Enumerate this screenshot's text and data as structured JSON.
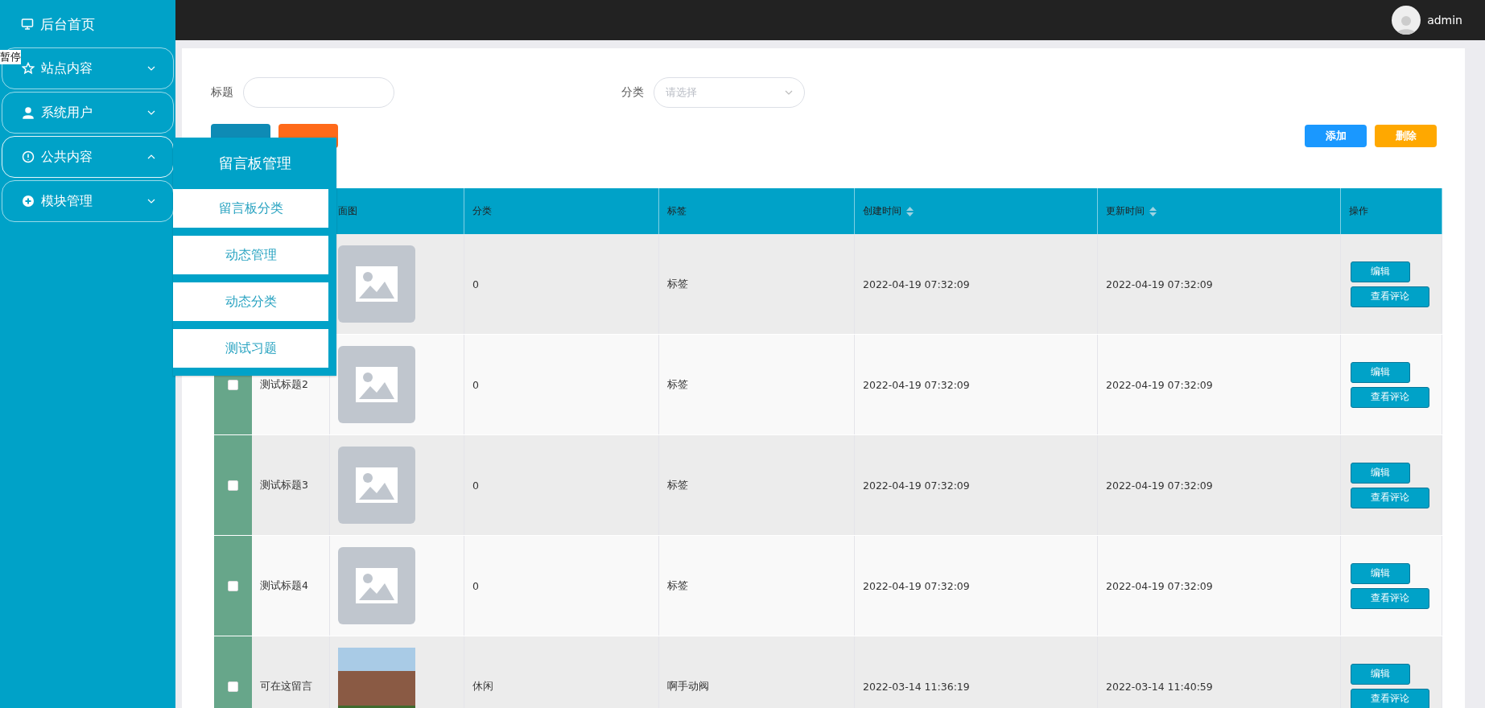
{
  "topbar": {
    "user": "admin"
  },
  "overlay_label": "暂停",
  "sidebar": {
    "home": "后台首页",
    "items": [
      {
        "label": "站点内容",
        "expanded": false
      },
      {
        "label": "系统用户",
        "expanded": false
      },
      {
        "label": "公共内容",
        "expanded": true
      },
      {
        "label": "模块管理",
        "expanded": false
      }
    ]
  },
  "submenu": {
    "title": "留言板管理",
    "items": [
      "留言板分类",
      "动态管理",
      "动态分类",
      "测试习题"
    ]
  },
  "filters": [
    {
      "kind": "text",
      "label": "标题"
    },
    {
      "kind": "select",
      "label": "分类",
      "placeholder": "请选择"
    }
  ],
  "search_buttons": [
    {
      "kind": "query"
    },
    {
      "kind": "reset"
    }
  ],
  "actions": [
    {
      "label": "添加",
      "kind": "add"
    },
    {
      "label": "删除",
      "kind": "delete"
    }
  ],
  "table": {
    "columns": [
      {
        "label": "面图",
        "sortable": false
      },
      {
        "label": "分类",
        "sortable": false
      },
      {
        "label": "标签",
        "sortable": false
      },
      {
        "label": "创建时间",
        "sortable": true
      },
      {
        "label": "更新时间",
        "sortable": true
      },
      {
        "label": "操作",
        "sortable": false
      }
    ],
    "rows": [
      {
        "kind": "placeholder",
        "category": "0",
        "tag": "标签",
        "created": "2022-04-19 07:32:09",
        "updated": "2022-04-19 07:32:09",
        "actions": [
          "编辑",
          "查看评论"
        ]
      },
      {
        "checked": false,
        "title": "测试标题2",
        "kind": "placeholder",
        "category": "0",
        "tag": "标签",
        "created": "2022-04-19 07:32:09",
        "updated": "2022-04-19 07:32:09",
        "actions": [
          "编辑",
          "查看评论"
        ]
      },
      {
        "checked": false,
        "title": "测试标题3",
        "kind": "placeholder",
        "category": "0",
        "tag": "标签",
        "created": "2022-04-19 07:32:09",
        "updated": "2022-04-19 07:32:09",
        "actions": [
          "编辑",
          "查看评论"
        ]
      },
      {
        "checked": false,
        "title": "测试标题4",
        "kind": "placeholder",
        "category": "0",
        "tag": "标签",
        "created": "2022-04-19 07:32:09",
        "updated": "2022-04-19 07:32:09",
        "actions": [
          "编辑",
          "查看评论"
        ]
      },
      {
        "checked": false,
        "title": "可在这留言",
        "kind": "photo",
        "category": "休闲",
        "tag": "啊手动阀",
        "created": "2022-03-14 11:36:19",
        "updated": "2022-03-14 11:40:59",
        "actions": [
          "编辑",
          "查看评论"
        ]
      }
    ]
  }
}
